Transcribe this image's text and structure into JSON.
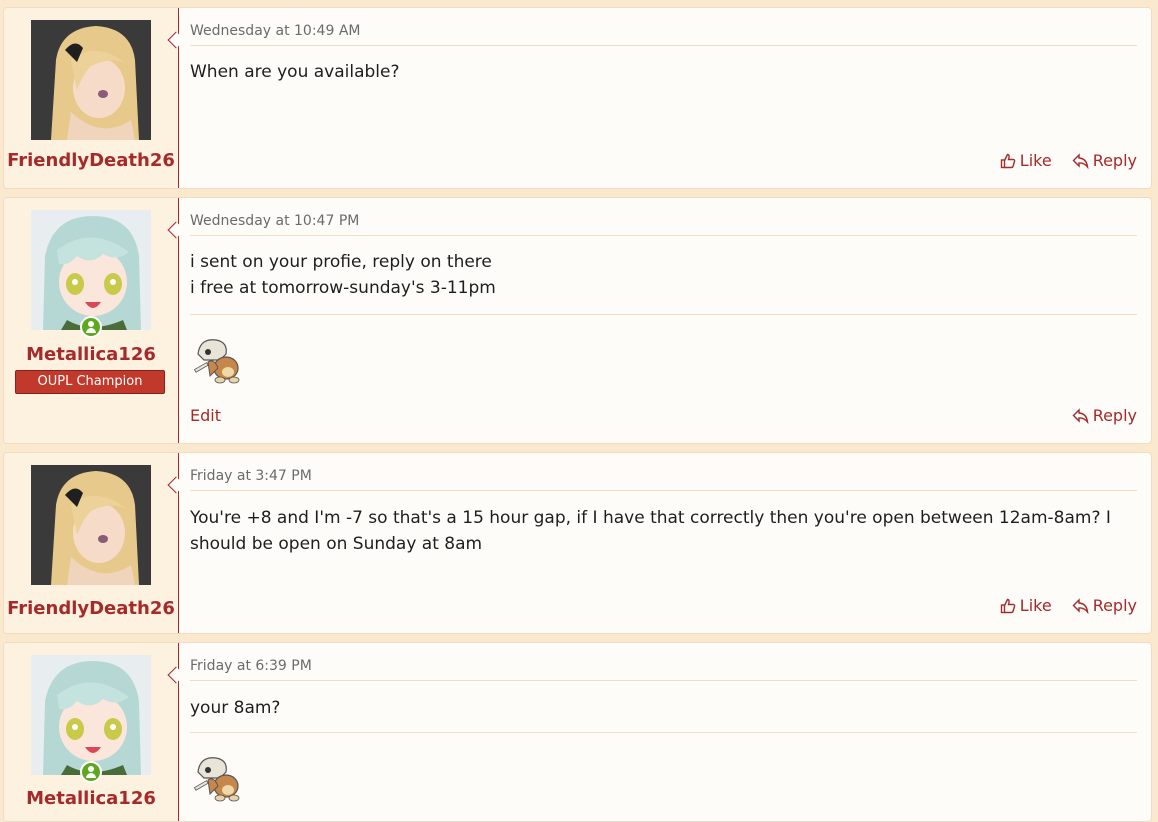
{
  "colors": {
    "accent": "#a52a2a",
    "page_bg": "#fbe9cf",
    "post_bg": "#fefcf8",
    "online": "#5ea81f",
    "banner": "#c0392b"
  },
  "posts": [
    {
      "username": "FriendlyDeath26",
      "date": "Wednesday at 10:49 AM",
      "lines": [
        "When are you available?"
      ],
      "like_label": "Like",
      "reply_label": "Reply"
    },
    {
      "username": "Metallica126",
      "banner": "OUPL Champion",
      "date": "Wednesday at 10:47 PM",
      "lines": [
        "i sent on your profie, reply on there",
        "i free at tomorrow-sunday's 3-11pm"
      ],
      "signature_icon": "cubone-sprite",
      "edit_label": "Edit",
      "reply_label": "Reply"
    },
    {
      "username": "FriendlyDeath26",
      "date": "Friday at 3:47 PM",
      "lines": [
        "You're +8 and I'm -7 so that's a 15 hour gap, if I have that correctly then you're open between 12am-8am? I",
        "should be open on Sunday at 8am"
      ],
      "like_label": "Like",
      "reply_label": "Reply"
    },
    {
      "username": "Metallica126",
      "date": "Friday at 6:39 PM",
      "lines": [
        "your 8am?"
      ],
      "signature_icon": "cubone-sprite"
    }
  ]
}
